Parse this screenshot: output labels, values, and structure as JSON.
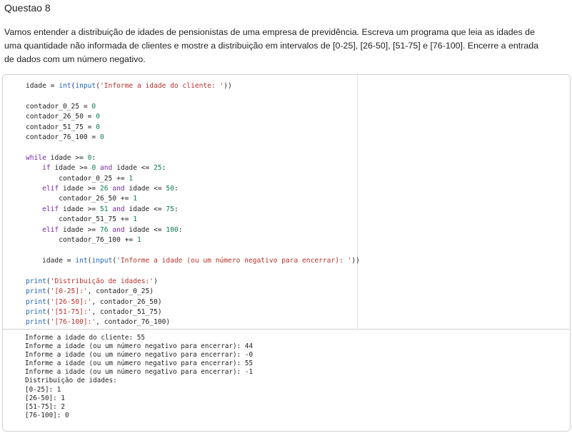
{
  "title": "Questao 8",
  "description": [
    "Vamos entender a distribuição de idades de pensionistas de uma empresa de previdência. Escreva um programa que leia as idades de",
    "uma quantidade não informada de clientes e mostre a distribuição em intervalos de [0-25], [26-50], [51-75] e [76-100]. Encerre a entrada",
    "de dados com um número negativo."
  ],
  "code": {
    "line_input": [
      "idade = ",
      "int",
      "(",
      "input",
      "(",
      "'Informe a idade do cliente: '",
      "))"
    ],
    "counters": [
      "contador_0_25 = ",
      "contador_26_50 = ",
      "contador_51_75 = ",
      "contador_76_100 = "
    ],
    "zero": "0",
    "while_kw": "while",
    "while_cond": " idade >= ",
    "while_tail": ":",
    "if_kw": "if",
    "elif_kw": "elif",
    "and_kw": "and",
    "cond_prefix": " idade >= ",
    "cond_mid": " idade <= ",
    "cond_end": ":",
    "ranges": [
      {
        "low": "0",
        "high": "25",
        "body": "contador_0_25 += "
      },
      {
        "low": "26",
        "high": "50",
        "body": "contador_26_50 += "
      },
      {
        "low": "51",
        "high": "75",
        "body": "contador_51_75 += "
      },
      {
        "low": "76",
        "high": "100",
        "body": "contador_76_100 += "
      }
    ],
    "one": "1",
    "line_reinput_prefix": "idade = ",
    "line_reinput_str": "'Informe a idade (ou um número negativo para encerrar): '",
    "print_kw": "print",
    "print_title": "'Distribuição de idades:'",
    "prints": [
      {
        "label": "'[0-25]:'",
        "var": "contador_0_25"
      },
      {
        "label": "'[26-50]:'",
        "var": "contador_26_50"
      },
      {
        "label": "'[51-75]:'",
        "var": "contador_51_75"
      },
      {
        "label": "'[76-100]:'",
        "var": "contador_76_100"
      }
    ]
  },
  "output": [
    "Informe a idade do cliente: 55",
    "Informe a idade (ou um número negativo para encerrar): 44",
    "Informe a idade (ou um número negativo para encerrar): -0",
    "Informe a idade (ou um número negativo para encerrar): 55",
    "Informe a idade (ou um número negativo para encerrar): -1",
    "Distribuição de idades:",
    "[0-25]: 1",
    "[26-50]: 1",
    "[51-75]: 2",
    "[76-100]: 0"
  ]
}
